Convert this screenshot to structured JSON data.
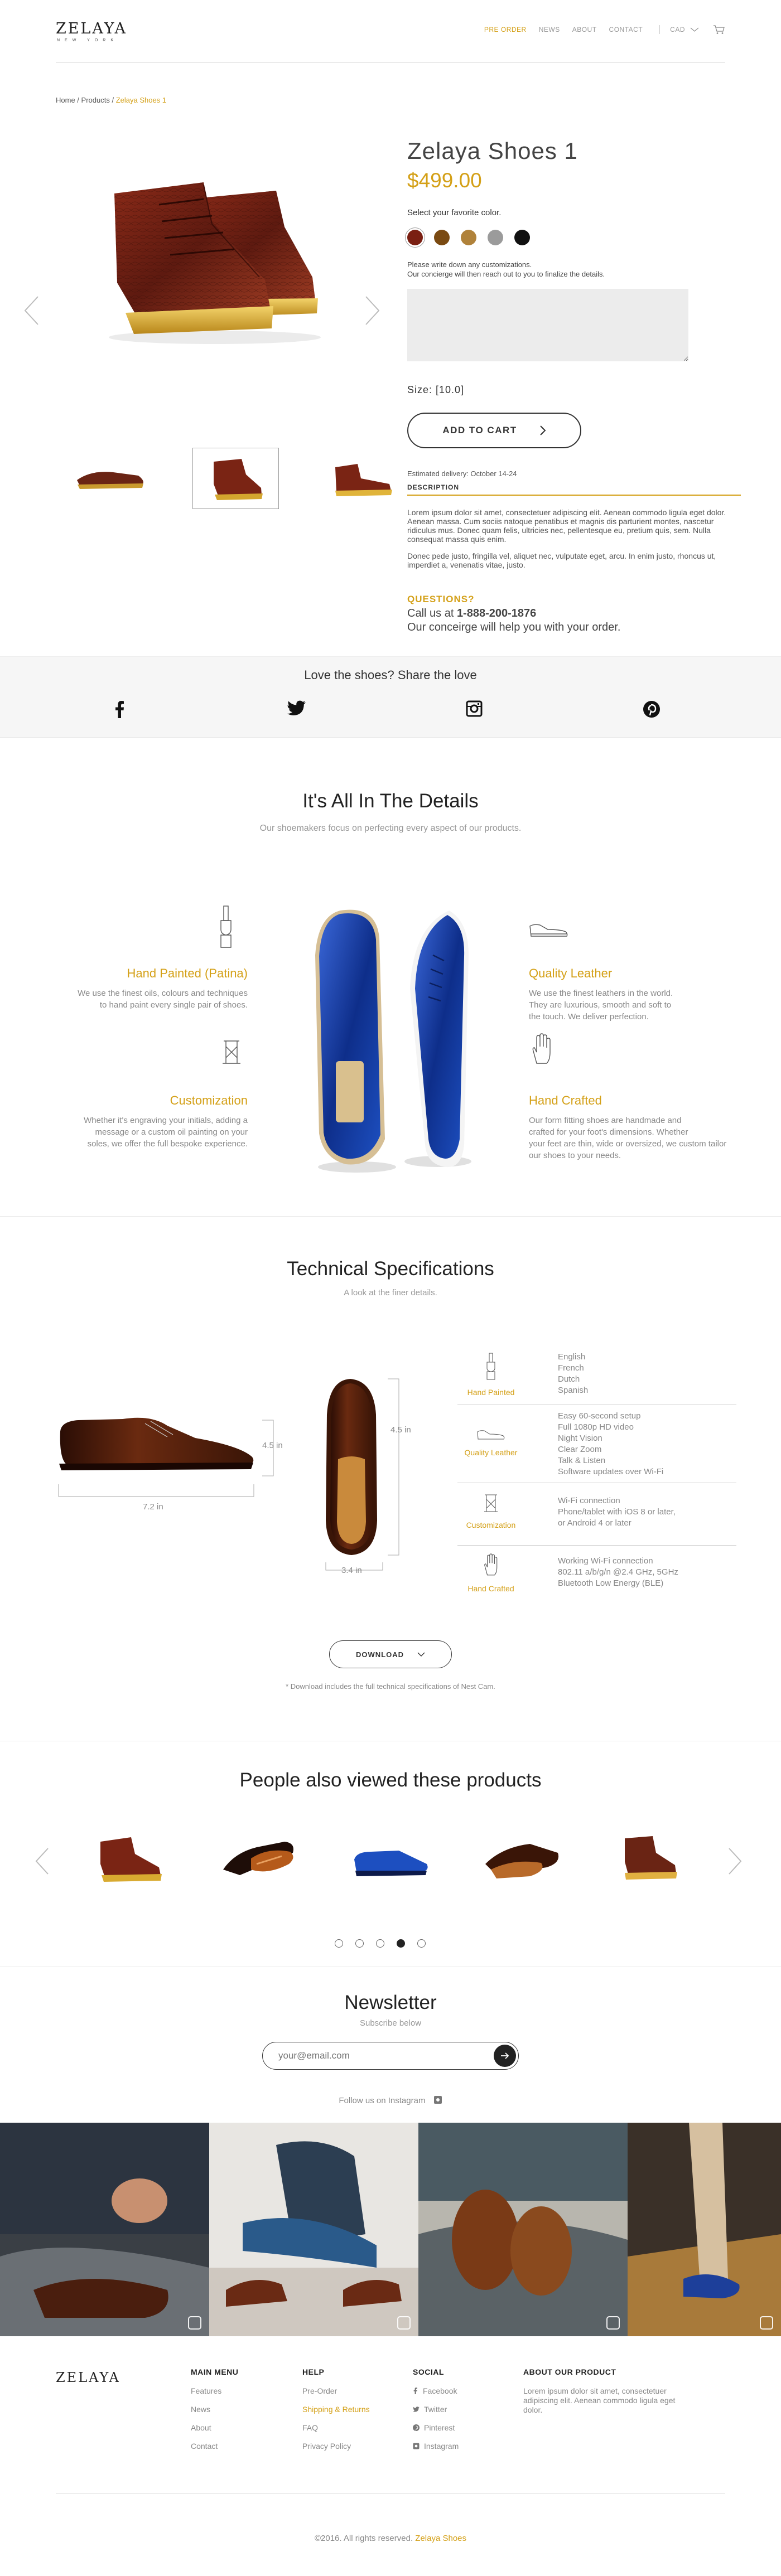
{
  "brand": {
    "name": "ZELAYA",
    "tagline": "NEW YORK"
  },
  "nav": {
    "items": [
      "PRE ORDER",
      "NEWS",
      "ABOUT",
      "CONTACT"
    ],
    "currency": "CAD",
    "active_index": 0
  },
  "breadcrumb": {
    "home": "Home",
    "sep1": " / ",
    "products": "Products",
    "sep2": " / ",
    "current": "Zelaya Shoes 1"
  },
  "product": {
    "title": "Zelaya Shoes 1",
    "price": "$499.00",
    "color_label": "Select your favorite color.",
    "colors": [
      "#7a1f12",
      "#7a4a12",
      "#b0823a",
      "#9b9b9b",
      "#111111"
    ],
    "customization_note_line1": "Please write down any customizations.",
    "customization_note_line2": "Our concierge will then reach out to you to finalize the details.",
    "size": "Size: [10.0]",
    "add_to_cart": "ADD TO CART",
    "delivery": "Estimated delivery: October 14-24",
    "description_label": "DESCRIPTION",
    "description_p1": "Lorem ipsum dolor sit amet, consectetuer adipiscing elit. Aenean commodo ligula eget dolor. Aenean massa. Cum sociis natoque penatibus et magnis dis parturient montes, nascetur ridiculus mus. Donec quam felis, ultricies nec, pellentesque eu, pretium quis, sem. Nulla consequat massa quis enim.",
    "description_p2": "Donec pede justo, fringilla vel, aliquet nec, vulputate eget, arcu. In enim justo, rhoncus ut, imperdiet a, venenatis vitae, justo.",
    "questions": "QUESTIONS?",
    "call_prefix": "Call us at ",
    "phone": "1-888-200-1876",
    "concierge": "Our conceirge will help you with your order."
  },
  "share": {
    "title": "Love the shoes? Share the love",
    "icons": [
      "facebook-icon",
      "twitter-icon",
      "instagram-icon",
      "pinterest-icon"
    ]
  },
  "details": {
    "title": "It's All In The Details",
    "subtitle": "Our shoemakers focus on perfecting every aspect of our products.",
    "features": [
      {
        "title": "Hand Painted (Patina)",
        "text_l1": "We use the finest oils, colours and techniques",
        "text_l2": "to hand paint every single pair of shoes.",
        "text_l3": ""
      },
      {
        "title": "Customization",
        "text_l1": "Whether it's engraving your initials, adding a",
        "text_l2": "message or a custom oil painting on your",
        "text_l3": "soles, we offer the full bespoke experience."
      },
      {
        "title": "Quality Leather",
        "text_l1": "We use the finest leathers in the world.",
        "text_l2": "They are luxurious, smooth and soft to",
        "text_l3": "the touch. We deliver perfection."
      },
      {
        "title": "Hand Crafted",
        "text_l1": "Our form fitting shoes are handmade and",
        "text_l2": "crafted for your foot's dimensions.  Whether",
        "text_l3": "your feet are thin, wide or oversized, we custom tailor our shoes to your needs."
      }
    ]
  },
  "tech": {
    "title": "Technical Specifications",
    "subtitle": "A look at the finer details.",
    "dims": {
      "length": "7.2 in",
      "height_side": "4.5 in",
      "height_top": "4.5 in",
      "width": "3.4 in"
    },
    "specs": [
      {
        "label": "Hand Painted",
        "items": [
          "English",
          "French",
          "Dutch",
          "Spanish"
        ]
      },
      {
        "label": "Quality Leather",
        "items": [
          "Easy 60-second setup",
          "Full 1080p HD video",
          "Night Vision",
          "Clear Zoom",
          "Talk & Listen",
          "Software updates over Wi-Fi"
        ]
      },
      {
        "label": "Customization",
        "items": [
          "Wi-Fi connection",
          "Phone/tablet with iOS 8 or later,",
          "or Android 4 or later"
        ]
      },
      {
        "label": "Hand Crafted",
        "items": [
          "Working Wi-Fi connection",
          "802.11 a/b/g/n @2.4 GHz, 5GHz",
          "Bluetooth Low Energy (BLE)"
        ]
      }
    ],
    "download": "DOWNLOAD",
    "download_note": "* Download includes the full technical specifications of Nest Cam."
  },
  "also_viewed": {
    "title": "People also viewed these products",
    "active_dot": 3
  },
  "newsletter": {
    "title": "Newsletter",
    "subtitle": "Subscribe below",
    "placeholder": "your@email.com",
    "follow": "Follow us on Instagram"
  },
  "footer": {
    "logo": "ZELAYA",
    "main_menu": {
      "title": "MAIN MENU",
      "items": [
        "Features",
        "News",
        "About",
        "Contact"
      ]
    },
    "help": {
      "title": "HELP",
      "items": [
        "Pre-Order",
        "Shipping & Returns",
        "FAQ",
        "Privacy Policy"
      ]
    },
    "social": {
      "title": "SOCIAL",
      "items": [
        "Facebook",
        "Twitter",
        "Pinterest",
        "Instagram"
      ]
    },
    "about": {
      "title": "ABOUT OUR PRODUCT",
      "text": "Lorem ipsum dolor sit amet, consectetuer adipiscing elit. Aenean commodo ligula eget dolor."
    },
    "copyright_prefix": "©2016. All rights reserved. ",
    "copyright_brand": "Zelaya Shoes"
  },
  "colors": {
    "accent": "#d4a017",
    "text": "#333333",
    "muted": "#888888"
  }
}
